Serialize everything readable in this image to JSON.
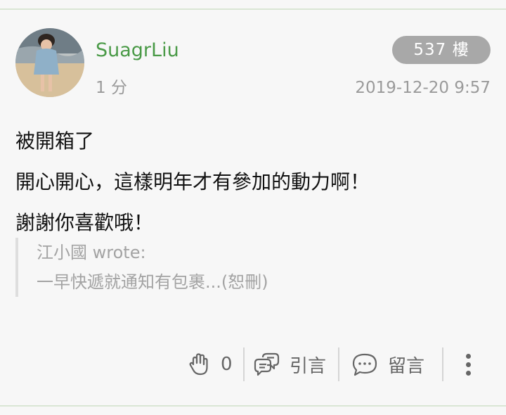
{
  "author": {
    "name": "SuagrLiu",
    "time_ago": "1 分"
  },
  "floor": "537 樓",
  "timestamp": "2019-12-20 9:57",
  "post": {
    "lines": [
      "被開箱了",
      "開心開心，這樣明年才有參加的動力啊！",
      "謝謝你喜歡哦！"
    ]
  },
  "quote": {
    "author_line": "江小國 wrote:",
    "text": "一早快遞就通知有包裹...(恕刪)"
  },
  "actions": {
    "like_count": "0",
    "quote_label": "引言",
    "comment_label": "留言"
  },
  "icons": {
    "like": "clap-hand-icon",
    "quote": "quote-bubble-icon",
    "comment": "comment-bubble-icon",
    "more": "more-vertical-icon"
  },
  "colors": {
    "username": "#4a9a47",
    "badge_bg": "#a8a8a8",
    "muted": "#9a9a9a"
  }
}
